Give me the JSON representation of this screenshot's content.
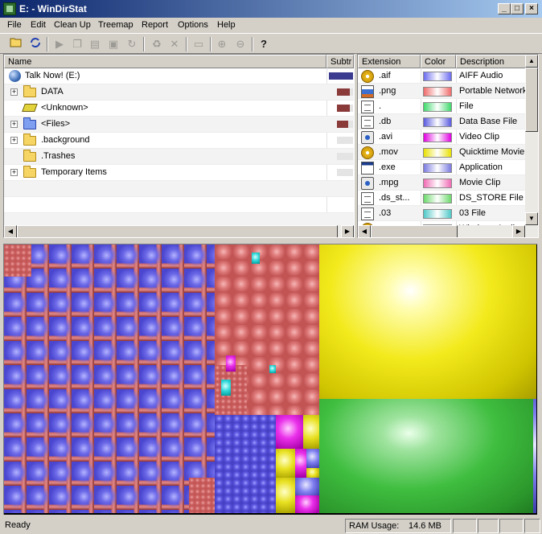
{
  "window": {
    "title": "E: - WinDirStat"
  },
  "menu": [
    "File",
    "Edit",
    "Clean Up",
    "Treemap",
    "Report",
    "Options",
    "Help"
  ],
  "toolbar": {
    "buttons": [
      "open-folder-icon",
      "refresh-icon",
      "run-icon",
      "copy-path-icon",
      "explorer-icon",
      "command-prompt-icon",
      "refresh-selected-icon",
      "recycle-bin-icon",
      "delete-icon",
      "new-folder-icon",
      "zoom-in-icon",
      "zoom-out-icon",
      "help-icon"
    ],
    "help_glyph": "?"
  },
  "directory_tree": {
    "columns": [
      "Name",
      "Subtr"
    ],
    "rows": [
      {
        "name": "Talk Now! (E:)",
        "icon": "drive-globe-icon",
        "expander": "",
        "bar_pct": 100,
        "bar_color": "#3b3b8f"
      },
      {
        "name": "DATA",
        "icon": "folder-icon",
        "expander": "+",
        "bar_pct": 82,
        "bar_color": "#8b3a3a"
      },
      {
        "name": "<Unknown>",
        "icon": "unknown-drive-icon",
        "expander": "",
        "bar_pct": 80,
        "bar_color": "#8b3a3a"
      },
      {
        "name": "<Files>",
        "icon": "files-folder-icon",
        "expander": "+",
        "bar_pct": 72,
        "bar_color": "#8b3a3a"
      },
      {
        "name": ".background",
        "icon": "folder-icon",
        "expander": "+",
        "bar_pct": 0,
        "bar_color": "#8b3a3a"
      },
      {
        "name": ".Trashes",
        "icon": "folder-icon",
        "expander": "",
        "bar_pct": 0,
        "bar_color": "#8b3a3a"
      },
      {
        "name": "Temporary Items",
        "icon": "folder-icon",
        "expander": "+",
        "bar_pct": 0,
        "bar_color": "#8b3a3a"
      }
    ]
  },
  "extension_list": {
    "columns": [
      "Extension",
      "Color",
      "Description"
    ],
    "rows": [
      {
        "ext": ".aif",
        "color": "#6b6bf0",
        "desc": "AIFF Audio",
        "icon": "audio"
      },
      {
        "ext": ".png",
        "color": "#f06b6b",
        "desc": "Portable Network Graphics",
        "icon": "img"
      },
      {
        "ext": ".",
        "color": "#3fd96b",
        "desc": "File",
        "icon": "doc"
      },
      {
        "ext": ".db",
        "color": "#5a5ae0",
        "desc": "Data Base File",
        "icon": "doc"
      },
      {
        "ext": ".avi",
        "color": "#e000e0",
        "desc": "Video Clip",
        "icon": "media"
      },
      {
        "ext": ".mov",
        "color": "#e8e000",
        "desc": "Quicktime Movie",
        "icon": "audio"
      },
      {
        "ext": ".exe",
        "color": "#7a7ae0",
        "desc": "Application",
        "icon": "win"
      },
      {
        "ext": ".mpg",
        "color": "#f06bb4",
        "desc": "Movie Clip",
        "icon": "media"
      },
      {
        "ext": ".ds_st...",
        "color": "#6bd96b",
        "desc": "DS_STORE File",
        "icon": "doc"
      },
      {
        "ext": ".03",
        "color": "#50c8c8",
        "desc": "03 File",
        "icon": "doc"
      },
      {
        "ext": "",
        "color": "#d060d0",
        "desc": "Windows Audio",
        "icon": "audio"
      }
    ]
  },
  "statusbar": {
    "status": "Ready",
    "ram_label": "RAM Usage:",
    "ram_value": "14.6 MB"
  }
}
